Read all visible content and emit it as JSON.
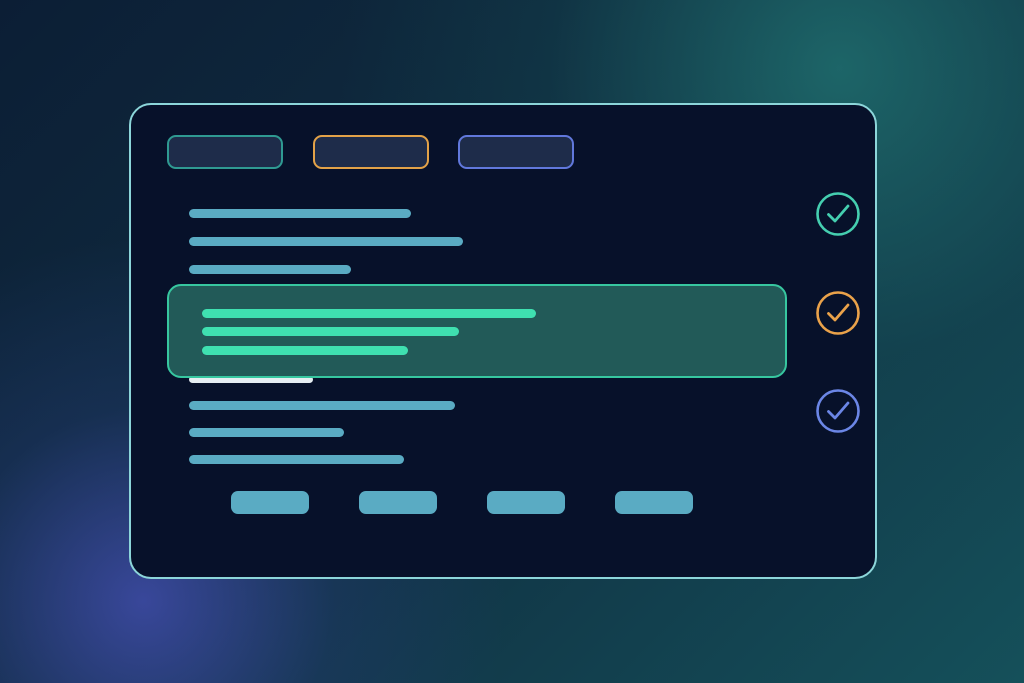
{
  "colors": {
    "panel_border": "#8cd6da",
    "panel_background": "#07112a",
    "text_line": "#5aabc3",
    "highlight_line": "#3fe0b0",
    "highlight_background": "#225a58",
    "highlight_border": "#37c7a0",
    "tab_teal": "#2f9a92",
    "tab_orange": "#e3a248",
    "tab_blue": "#6178dc",
    "check_teal": "#45cfb0",
    "check_orange": "#eaa24a",
    "check_blue": "#6b86e6"
  },
  "icons": {
    "check_top": "check-circle-icon",
    "check_middle": "check-circle-icon",
    "check_bottom": "check-circle-icon"
  }
}
